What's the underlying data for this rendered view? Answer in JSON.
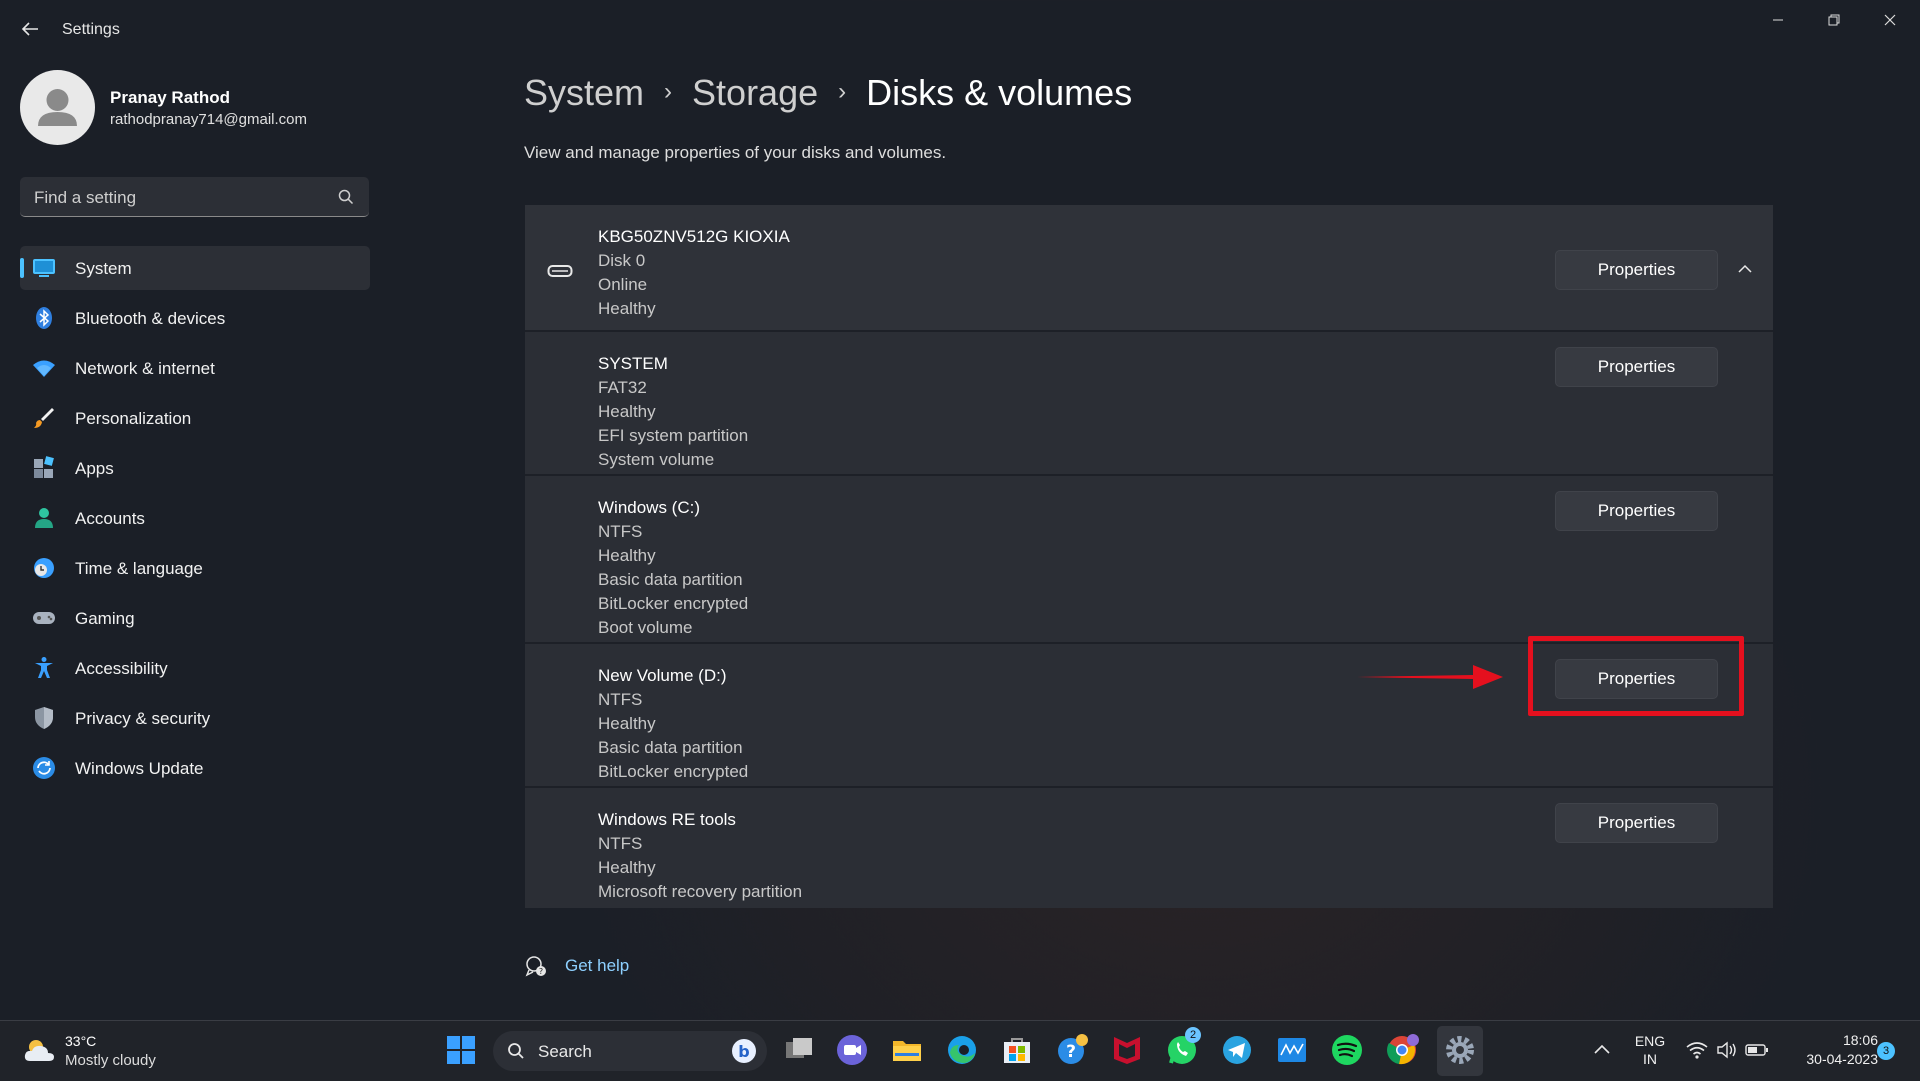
{
  "window": {
    "title": "Settings"
  },
  "profile": {
    "name": "Pranay Rathod",
    "email": "rathodpranay714@gmail.com"
  },
  "search": {
    "placeholder": "Find a setting"
  },
  "nav": {
    "items": [
      {
        "label": "System",
        "icon": "system-icon",
        "active": true
      },
      {
        "label": "Bluetooth & devices",
        "icon": "bluetooth-icon"
      },
      {
        "label": "Network & internet",
        "icon": "wifi-icon"
      },
      {
        "label": "Personalization",
        "icon": "brush-icon"
      },
      {
        "label": "Apps",
        "icon": "apps-icon"
      },
      {
        "label": "Accounts",
        "icon": "accounts-icon"
      },
      {
        "label": "Time & language",
        "icon": "time-language-icon"
      },
      {
        "label": "Gaming",
        "icon": "gamepad-icon"
      },
      {
        "label": "Accessibility",
        "icon": "accessibility-icon"
      },
      {
        "label": "Privacy & security",
        "icon": "shield-icon"
      },
      {
        "label": "Windows Update",
        "icon": "update-icon"
      }
    ]
  },
  "breadcrumb": {
    "items": [
      "System",
      "Storage",
      "Disks & volumes"
    ]
  },
  "page": {
    "description": "View and manage properties of your disks and volumes."
  },
  "disks": {
    "button_label": "Properties",
    "header": {
      "lines": [
        "KBG50ZNV512G KIOXIA",
        "Disk 0",
        "Online",
        "Healthy"
      ]
    },
    "volumes": [
      {
        "lines": [
          "SYSTEM",
          "FAT32",
          "Healthy",
          "EFI system partition",
          "System volume"
        ]
      },
      {
        "lines": [
          "Windows (C:)",
          "NTFS",
          "Healthy",
          "Basic data partition",
          "BitLocker encrypted",
          "Boot volume"
        ]
      },
      {
        "lines": [
          "New Volume (D:)",
          "NTFS",
          "Healthy",
          "Basic data partition",
          "BitLocker encrypted"
        ],
        "highlighted": true
      },
      {
        "lines": [
          "Windows RE tools",
          "NTFS",
          "Healthy",
          "Microsoft recovery partition"
        ]
      }
    ]
  },
  "help": {
    "label": "Get help"
  },
  "taskbar": {
    "weather": {
      "temp": "33°C",
      "condition": "Mostly cloudy"
    },
    "search_label": "Search",
    "icons": [
      "start-icon",
      "bing-icon",
      "task-view-icon",
      "meet-icon",
      "file-explorer-icon",
      "edge-icon",
      "store-icon",
      "help-app-icon",
      "mcafee-icon",
      "whatsapp-icon",
      "telegram-icon",
      "mvhp-icon",
      "spotify-icon",
      "chrome-icon",
      "settings-icon"
    ],
    "whatsapp_badge": "2",
    "language": {
      "line1": "ENG",
      "line2": "IN"
    },
    "clock": {
      "time": "18:06",
      "date": "30-04-2023"
    },
    "notification_count": "3"
  },
  "colors": {
    "accent": "#4cc2ff",
    "annotation": "#e5101e",
    "link": "#8ed0ff"
  }
}
